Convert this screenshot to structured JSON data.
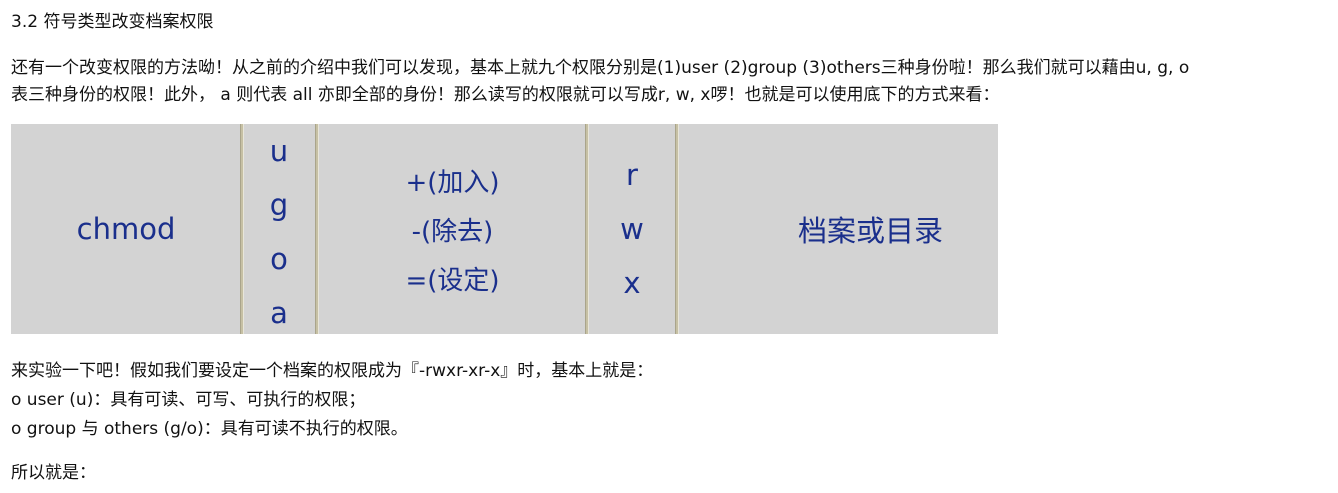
{
  "heading": "3.2 符号类型改变档案权限",
  "intro_line1": "还有一个改变权限的方法呦！从之前的介绍中我们可以发现，基本上就九个权限分别是(1)user (2)group (3)others三种身份啦！那么我们就可以藉由u, g, o",
  "intro_line2": "表三种身份的权限！此外， a 则代表 all 亦即全部的身份！那么读写的权限就可以写成r, w, x啰！也就是可以使用底下的方式来看：",
  "figure": {
    "command": "chmod",
    "who": [
      "u",
      "g",
      "o",
      "a"
    ],
    "operators": [
      "+(加入)",
      "-(除去)",
      "=(设定)"
    ],
    "permissions": [
      "r",
      "w",
      "x"
    ],
    "target": "档案或目录",
    "colors": {
      "background": "#d3d3d3",
      "text": "#1a2f8c",
      "divider": "#c6c0a4"
    }
  },
  "after_line": "来实验一下吧！假如我们要设定一个档案的权限成为『-rwxr-xr-x』时，基本上就是：",
  "bullets": [
    "o user (u)：具有可读、可写、可执行的权限；",
    "o group 与 others (g/o)：具有可读不执行的权限。"
  ],
  "closing": "所以就是："
}
